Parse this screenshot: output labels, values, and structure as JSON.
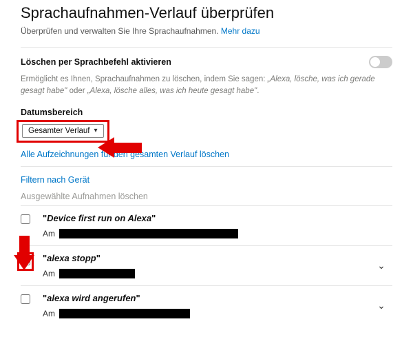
{
  "header": {
    "title": "Sprachaufnahmen-Verlauf überprüfen",
    "subtitle_prefix": "Überprüfen und verwalten Sie Ihre Sprachaufnahmen. ",
    "subtitle_link": "Mehr dazu"
  },
  "voice_delete": {
    "label": "Löschen per Sprachbefehl aktivieren",
    "enabled": false,
    "helper_prefix": "Ermöglicht es Ihnen, Sprachaufnahmen zu löschen, indem Sie sagen: ",
    "helper_quote1": "„Alexa, lösche, was ich gerade gesagt habe\"",
    "helper_or": " oder ",
    "helper_quote2": "„Alexa, lösche alles, was ich heute gesagt habe\"",
    "helper_suffix": "."
  },
  "date_range": {
    "label": "Datumsbereich",
    "selected": "Gesamter Verlauf"
  },
  "actions": {
    "delete_all": "Alle Aufzeichnungen für den gesamten Verlauf löschen",
    "filter_device": "Filtern nach Gerät",
    "delete_selected": "Ausgewählte Aufnahmen löschen"
  },
  "recordings": [
    {
      "text": "Device first run on Alexa",
      "meta_prefix": "Am",
      "expandable": false,
      "highlight_checkbox": false,
      "redact_class": "w1"
    },
    {
      "text": "alexa stopp",
      "meta_prefix": "Am",
      "expandable": true,
      "highlight_checkbox": true,
      "redact_class": "w2"
    },
    {
      "text": "alexa wird angerufen",
      "meta_prefix": "Am",
      "expandable": true,
      "highlight_checkbox": false,
      "redact_class": "w3"
    }
  ]
}
